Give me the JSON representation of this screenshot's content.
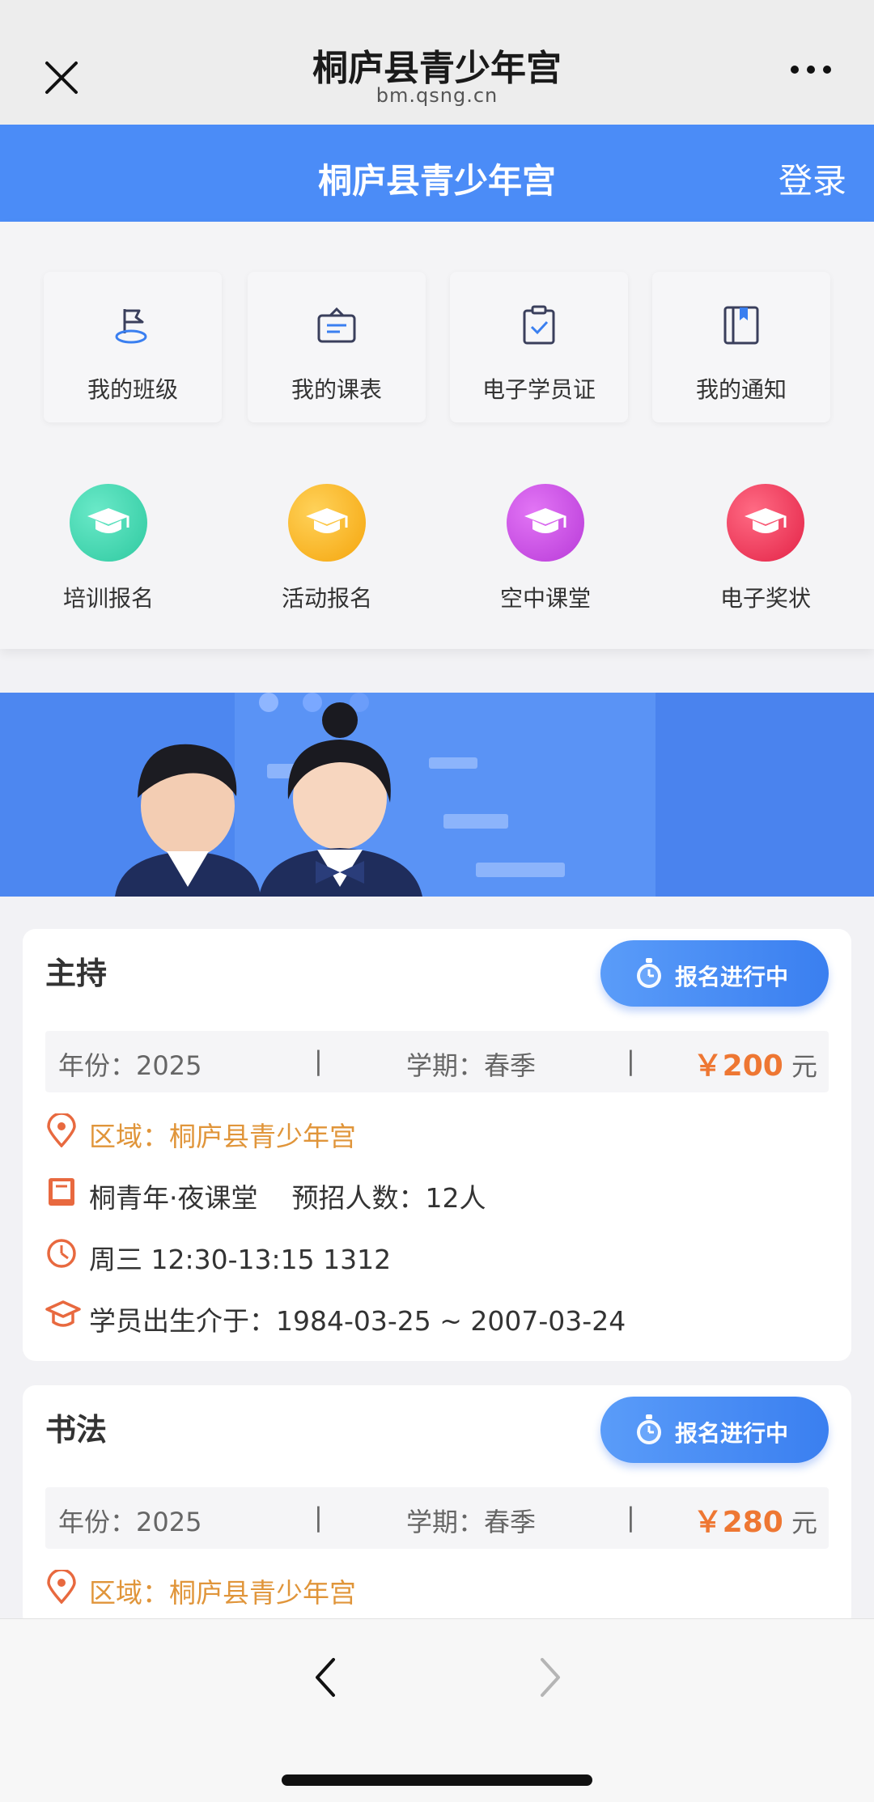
{
  "wechat_bar": {
    "title": "桐庐县青少年宫",
    "url": "bm.qsng.cn"
  },
  "header": {
    "title": "桐庐县青少年宫",
    "login_label": "登录",
    "accent_color": "#4b8cf7"
  },
  "quick_menu": [
    {
      "label": "我的班级",
      "icon": "flag-icon"
    },
    {
      "label": "我的课表",
      "icon": "schedule-icon"
    },
    {
      "label": "电子学员证",
      "icon": "clipboard-check-icon"
    },
    {
      "label": "我的通知",
      "icon": "notice-book-icon"
    }
  ],
  "category_menu": [
    {
      "label": "培训报名",
      "icon": "graduation-cap-icon",
      "color": "#3fd6b0"
    },
    {
      "label": "活动报名",
      "icon": "graduation-cap-icon",
      "color": "#f9b21e"
    },
    {
      "label": "空中课堂",
      "icon": "graduation-cap-icon",
      "color": "#cf47e6"
    },
    {
      "label": "电子奖状",
      "icon": "graduation-cap-icon",
      "color": "#f03b5a"
    }
  ],
  "banner": {
    "description_icon": "children-banner-image"
  },
  "courses": [
    {
      "title": "主持",
      "status": "报名进行中",
      "year": "年份：2025",
      "separator": "|",
      "term": "学期：春季",
      "price_symbol": "￥",
      "price": "200",
      "price_unit": "元",
      "area": "区域：桐庐县青少年宫",
      "class_info": "桐青年·夜课堂    预招人数：12人",
      "time": "周三 12:30-13:15 1312",
      "birth_range": "学员出生介于：1984-03-25 ~ 2007-03-24"
    },
    {
      "title": "书法",
      "status": "报名进行中",
      "year": "年份：2025",
      "separator": "|",
      "term": "学期：春季",
      "price_symbol": "￥",
      "price": "280",
      "price_unit": "元",
      "area": "区域：桐庐县青少年宫"
    }
  ],
  "colors": {
    "price": "#ee7733",
    "area_text": "#e0953a",
    "status_button": "#3a7ff0"
  }
}
